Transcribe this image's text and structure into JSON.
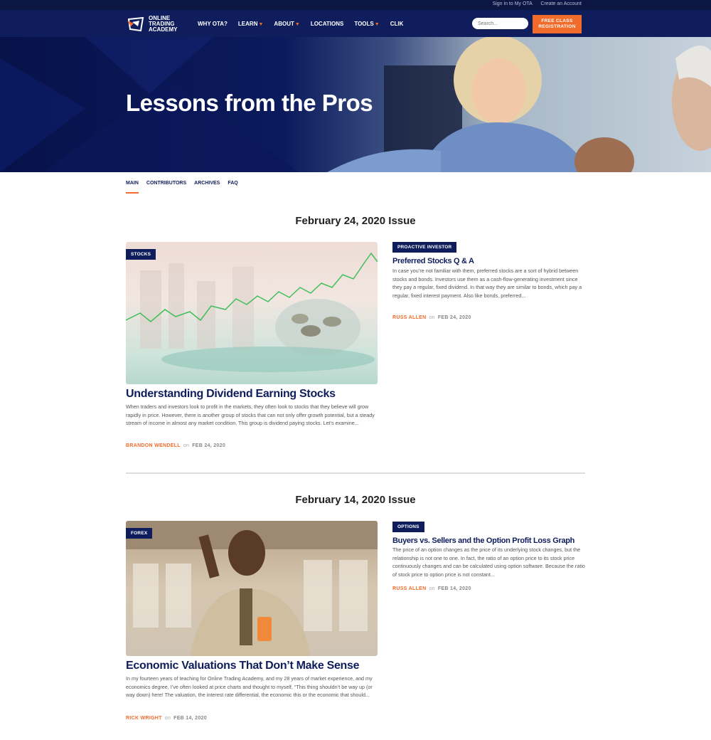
{
  "topbar": {
    "signin": "Sign in to My OTA",
    "create": "Create an Account"
  },
  "brand": {
    "name": "ONLINE TRADING ACADEMY"
  },
  "nav": [
    {
      "label": "WHY OTA?",
      "caret": false
    },
    {
      "label": "LEARN",
      "caret": true
    },
    {
      "label": "ABOUT",
      "caret": true
    },
    {
      "label": "LOCATIONS",
      "caret": false
    },
    {
      "label": "TOOLS",
      "caret": true
    },
    {
      "label": "CLIK",
      "caret": false
    }
  ],
  "search": {
    "placeholder": "Search..."
  },
  "cta": {
    "label": "FREE CLASS REGISTRATION"
  },
  "hero": {
    "title": "Lessons from the Pros"
  },
  "tabs": [
    "MAIN",
    "CONTRIBUTORS",
    "ARCHIVES",
    "FAQ"
  ],
  "issues": [
    {
      "title": "February 24, 2020 Issue",
      "feature": {
        "badge": "STOCKS",
        "headline": "Understanding Dividend Earning Stocks",
        "excerpt": "When traders and investors look to profit in the markets, they often look to stocks that they believe will grow rapidly in price. However, there is another group of stocks that can not only offer growth potential, but a steady stream of income in almost any market condition. This group is dividend paying stocks. Let’s examine...",
        "author": "BRANDON WENDELL",
        "on": "on",
        "date": "FEB 24, 2020"
      },
      "side": {
        "badge": "PROACTIVE INVESTOR",
        "headline": "Preferred Stocks Q & A",
        "excerpt": "In case you’re not familiar with them, preferred stocks are a sort of hybrid between stocks and bonds. Investors use them as a cash-flow-generating investment since they pay a regular, fixed dividend. In that way they are similar to bonds, which pay a regular, fixed interest payment. Also like bonds, preferred...",
        "author": "RUSS ALLEN",
        "on": "on",
        "date": "FEB 24, 2020"
      }
    },
    {
      "title": "February 14, 2020 Issue",
      "feature": {
        "badge": "FOREX",
        "headline": "Economic Valuations That Don’t Make Sense",
        "excerpt": "In my fourteen years of teaching for Online Trading Academy, and my 28 years of market experience, and my economics degree, I’ve often looked at price charts and thought to myself, “This thing shouldn’t be way up (or way down) here! The valuation, the interest rate differential, the economic this or the economic that should...",
        "author": "RICK WRIGHT",
        "on": "on",
        "date": "FEB 14, 2020"
      },
      "side": {
        "badge": "OPTIONS",
        "headline": "Buyers vs. Sellers and the Option Profit Loss Graph",
        "excerpt": "The price of an option changes as the price of its underlying stock changes, but the relationship is not one to one. In fact, the ratio of an option price to its stock price continuously changes and can be calculated using option software. Because the ratio of stock price to option price is not constant...",
        "author": "RUSS ALLEN",
        "on": "on",
        "date": "FEB 14, 2020"
      }
    }
  ],
  "colors": {
    "navy": "#0f1d5c",
    "orange": "#f26b2a"
  }
}
